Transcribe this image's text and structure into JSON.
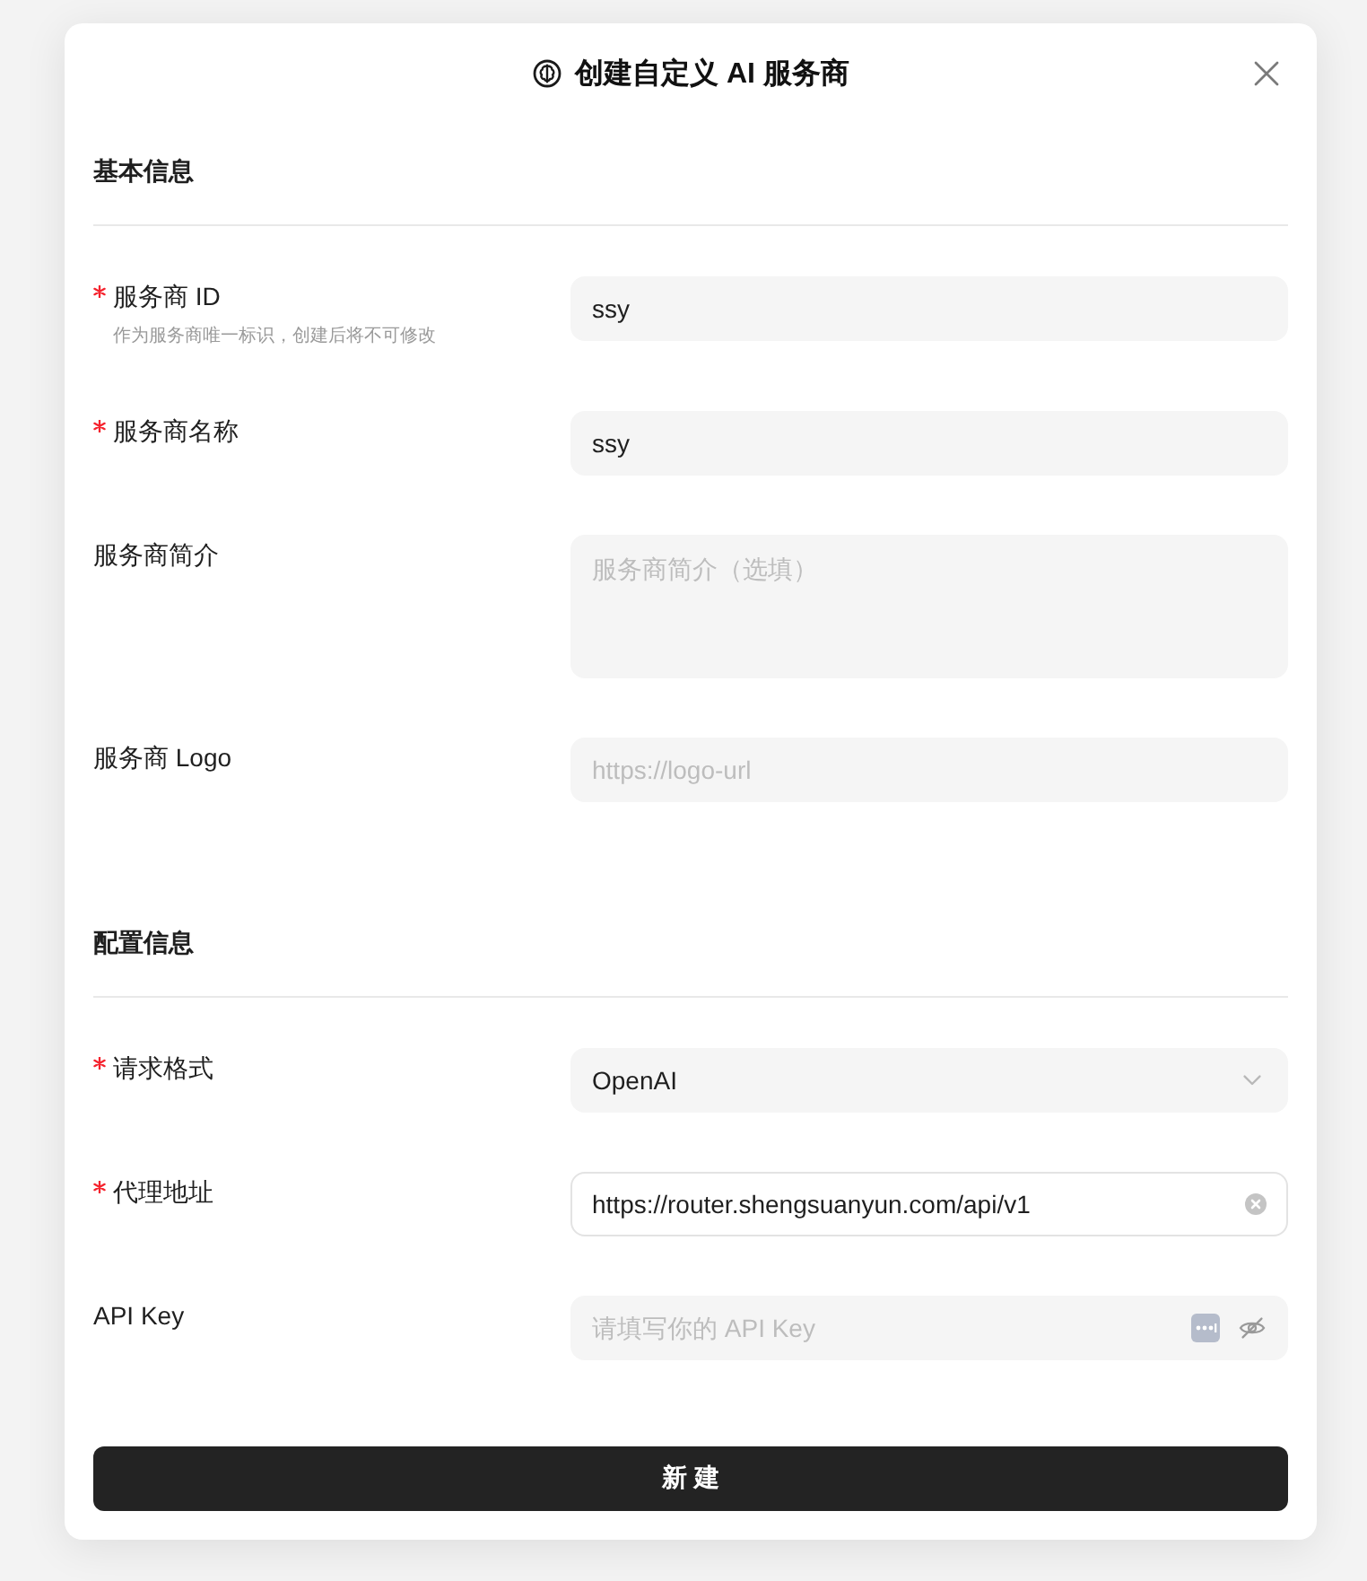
{
  "dialog": {
    "title": "创建自定义 AI 服务商"
  },
  "sections": [
    {
      "heading": "基本信息",
      "fields": [
        {
          "kind": "text",
          "label": "服务商 ID",
          "required": true,
          "hint": "作为服务商唯一标识，创建后将不可修改",
          "value": "ssy",
          "focused": false
        },
        {
          "kind": "text",
          "label": "服务商名称",
          "required": true,
          "value": "ssy",
          "focused": false
        },
        {
          "kind": "textarea",
          "label": "服务商简介",
          "required": false,
          "placeholder": "服务商简介（选填）",
          "focused": false
        },
        {
          "kind": "text",
          "label": "服务商 Logo",
          "required": false,
          "placeholder": "https://logo-url",
          "focused": false
        }
      ]
    },
    {
      "heading": "配置信息",
      "fields": [
        {
          "kind": "select",
          "label": "请求格式",
          "required": true,
          "value": "OpenAI",
          "focused": false
        },
        {
          "kind": "text",
          "label": "代理地址",
          "required": true,
          "value": "https://router.shengsuanyun.com/api/v1",
          "focused": true
        },
        {
          "kind": "password",
          "label": "API Key",
          "required": false,
          "placeholder": "请填写你的 API Key",
          "focused": false
        }
      ]
    }
  ],
  "submit_button": "新 建"
}
